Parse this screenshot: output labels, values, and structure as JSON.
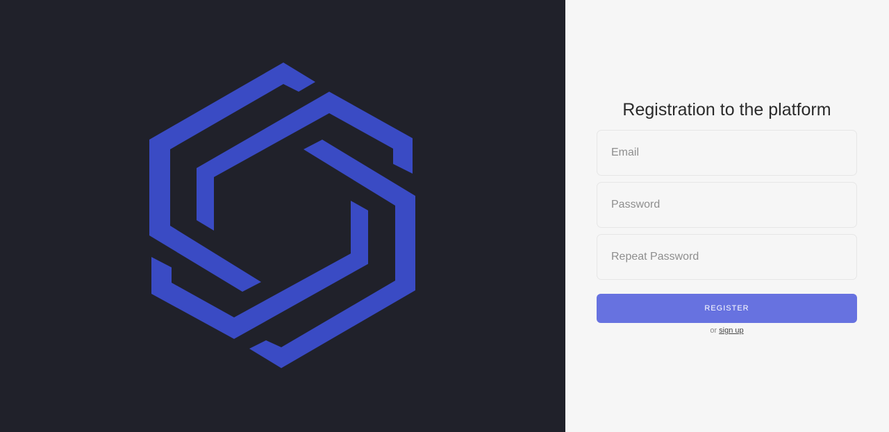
{
  "brand": {
    "logo_icon": "hexagon-link-logo",
    "background_color": "#20212a",
    "logo_color": "#3a4bc4"
  },
  "form": {
    "title": "Registration to the platform",
    "email_placeholder": "Email",
    "password_placeholder": "Password",
    "repeat_password_placeholder": "Repeat Password",
    "register_label": "REGISTER",
    "alt_prefix": "or",
    "alt_link_label": "sign up",
    "button_color": "#6772e0",
    "background_color": "#f6f6f6"
  }
}
